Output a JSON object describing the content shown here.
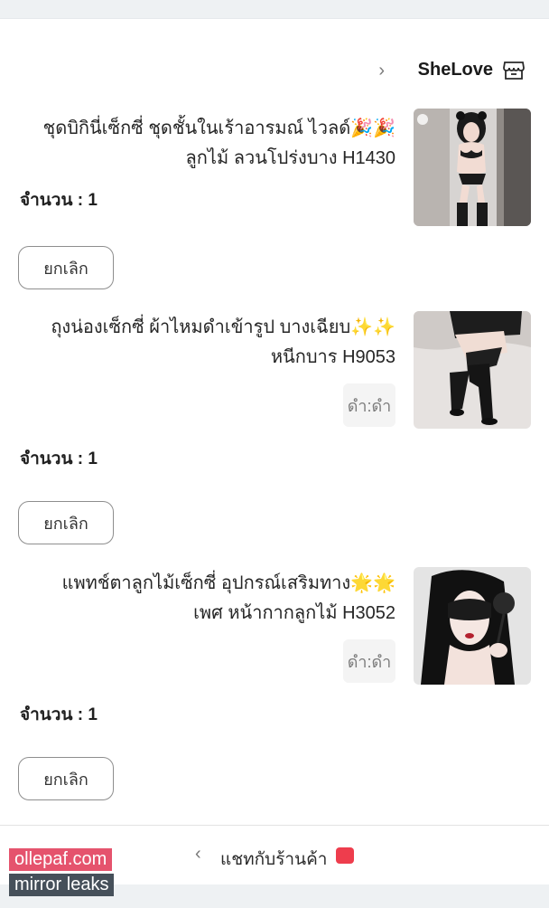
{
  "store": {
    "name": "SheLove",
    "icon": "store-icon",
    "chevron": "›"
  },
  "items": [
    {
      "title": "🎉🎉ชุดบิกินี่เซ็กซี่ ชุดชั้นในเร้าอารมณ์ ไวลด์ ลูกไม้ ลวนโปร่งบาง H1430",
      "variant": "",
      "qty": "จำนวน : 1",
      "cancel": "ยกเลิก",
      "thumb": "product-photo-lingerie"
    },
    {
      "title": "✨✨ถุงน่องเซ็กซี่ ผ้าไหมดำเข้ารูป บางเฉียบ หนีกบาร H9053",
      "variant": "ดำ:ดำ",
      "qty": "จำนวน : 1",
      "cancel": "ยกเลิก",
      "thumb": "product-photo-stockings"
    },
    {
      "title": "🌟🌟แพทช์ตาลูกไม้เซ็กซี่ อุปกรณ์เสริมทาง เพศ หน้ากากลูกไม้ H3052",
      "variant": "ดำ:ดำ",
      "qty": "จำนวน : 1",
      "cancel": "ยกเลิก",
      "thumb": "product-photo-lace-mask"
    }
  ],
  "footer": {
    "chat_label": "แชทกับร้านค้า",
    "chevron": "‹"
  },
  "watermark": {
    "line1": "ollepaf.com",
    "line2": "mirror leaks"
  }
}
